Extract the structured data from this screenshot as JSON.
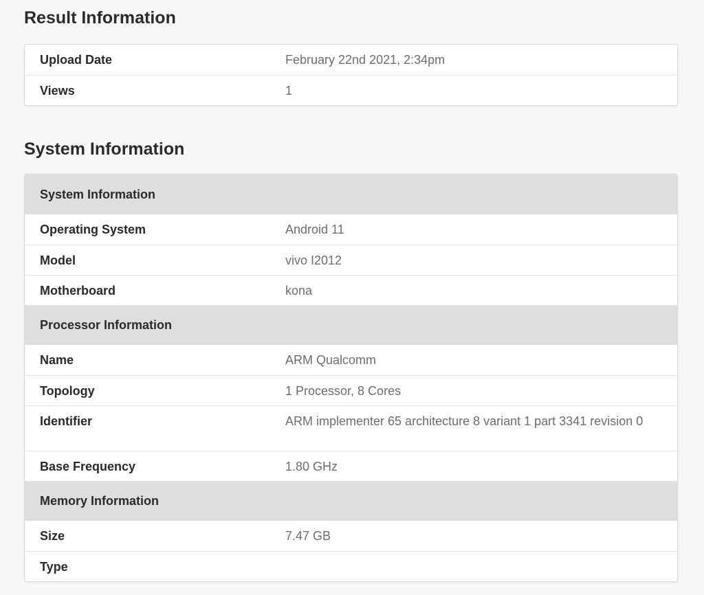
{
  "result_section": {
    "title": "Result Information",
    "rows": [
      {
        "label": "Upload Date",
        "value": "February 22nd 2021, 2:34pm"
      },
      {
        "label": "Views",
        "value": "1"
      }
    ]
  },
  "system_section": {
    "title": "System Information",
    "groups": [
      {
        "header": "System Information",
        "rows": [
          {
            "label": "Operating System",
            "value": "Android 11"
          },
          {
            "label": "Model",
            "value": "vivo I2012"
          },
          {
            "label": "Motherboard",
            "value": "kona"
          }
        ]
      },
      {
        "header": "Processor Information",
        "rows": [
          {
            "label": "Name",
            "value": "ARM Qualcomm"
          },
          {
            "label": "Topology",
            "value": "1 Processor, 8 Cores"
          },
          {
            "label": "Identifier",
            "value": "ARM implementer 65 architecture 8 variant 1 part 3341 revision 0"
          },
          {
            "label": "Base Frequency",
            "value": "1.80 GHz"
          }
        ]
      },
      {
        "header": "Memory Information",
        "rows": [
          {
            "label": "Size",
            "value": "7.47 GB"
          },
          {
            "label": "Type",
            "value": ""
          }
        ]
      }
    ]
  }
}
